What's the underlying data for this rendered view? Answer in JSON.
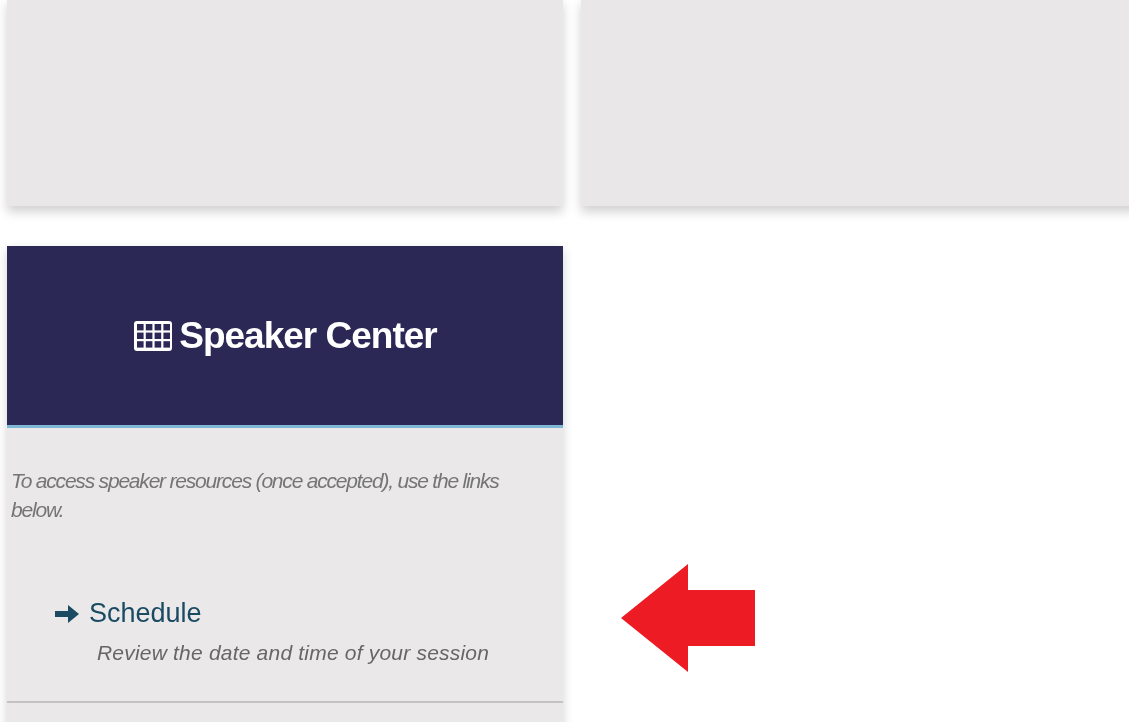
{
  "top_cards": [
    {
      "kind": "blank"
    },
    {
      "kind": "blank"
    }
  ],
  "speaker_center": {
    "title": "Speaker Center",
    "intro": "To access speaker resources (once accepted), use the links below.",
    "links": [
      {
        "label": "Schedule",
        "description": "Review the date and time of your session"
      }
    ]
  }
}
